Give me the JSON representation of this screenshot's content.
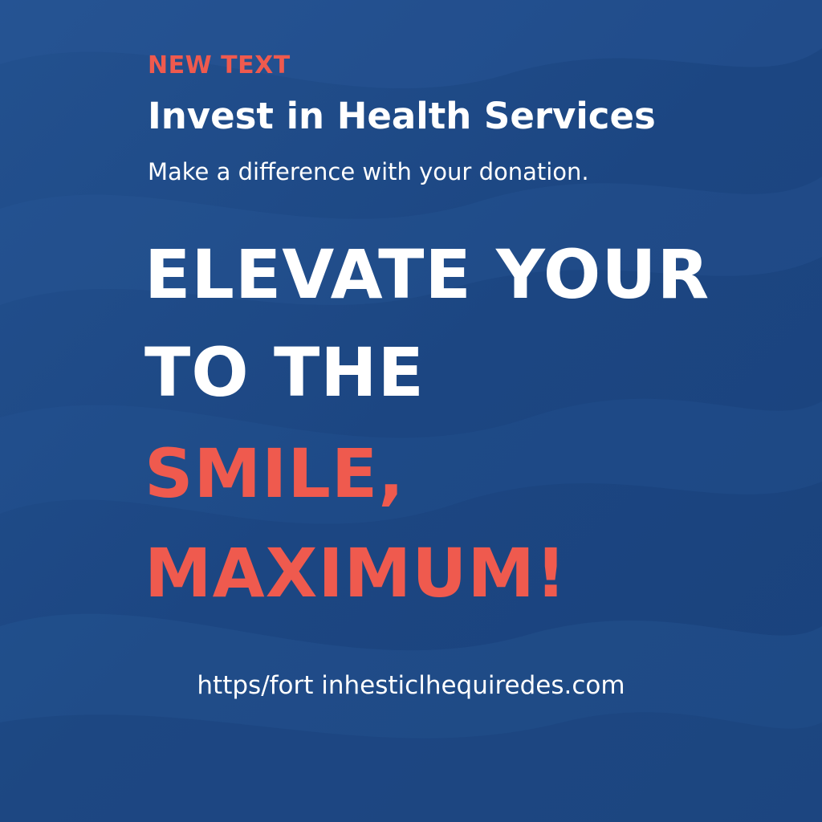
{
  "poster": {
    "eyebrow": "NEW TEXT",
    "title": "Invest in Health Services",
    "subtitle": "Make a difference with your donation.",
    "headline_lines": [
      "ELEVATE YOUR",
      "TO THE",
      "SMILE,",
      "MAXIMUM!"
    ],
    "url": "https/fort inhesticlhequiredes.com"
  },
  "colors": {
    "background": "#1f4a86",
    "accent": "#ef5a4e",
    "text": "#ffffff"
  }
}
